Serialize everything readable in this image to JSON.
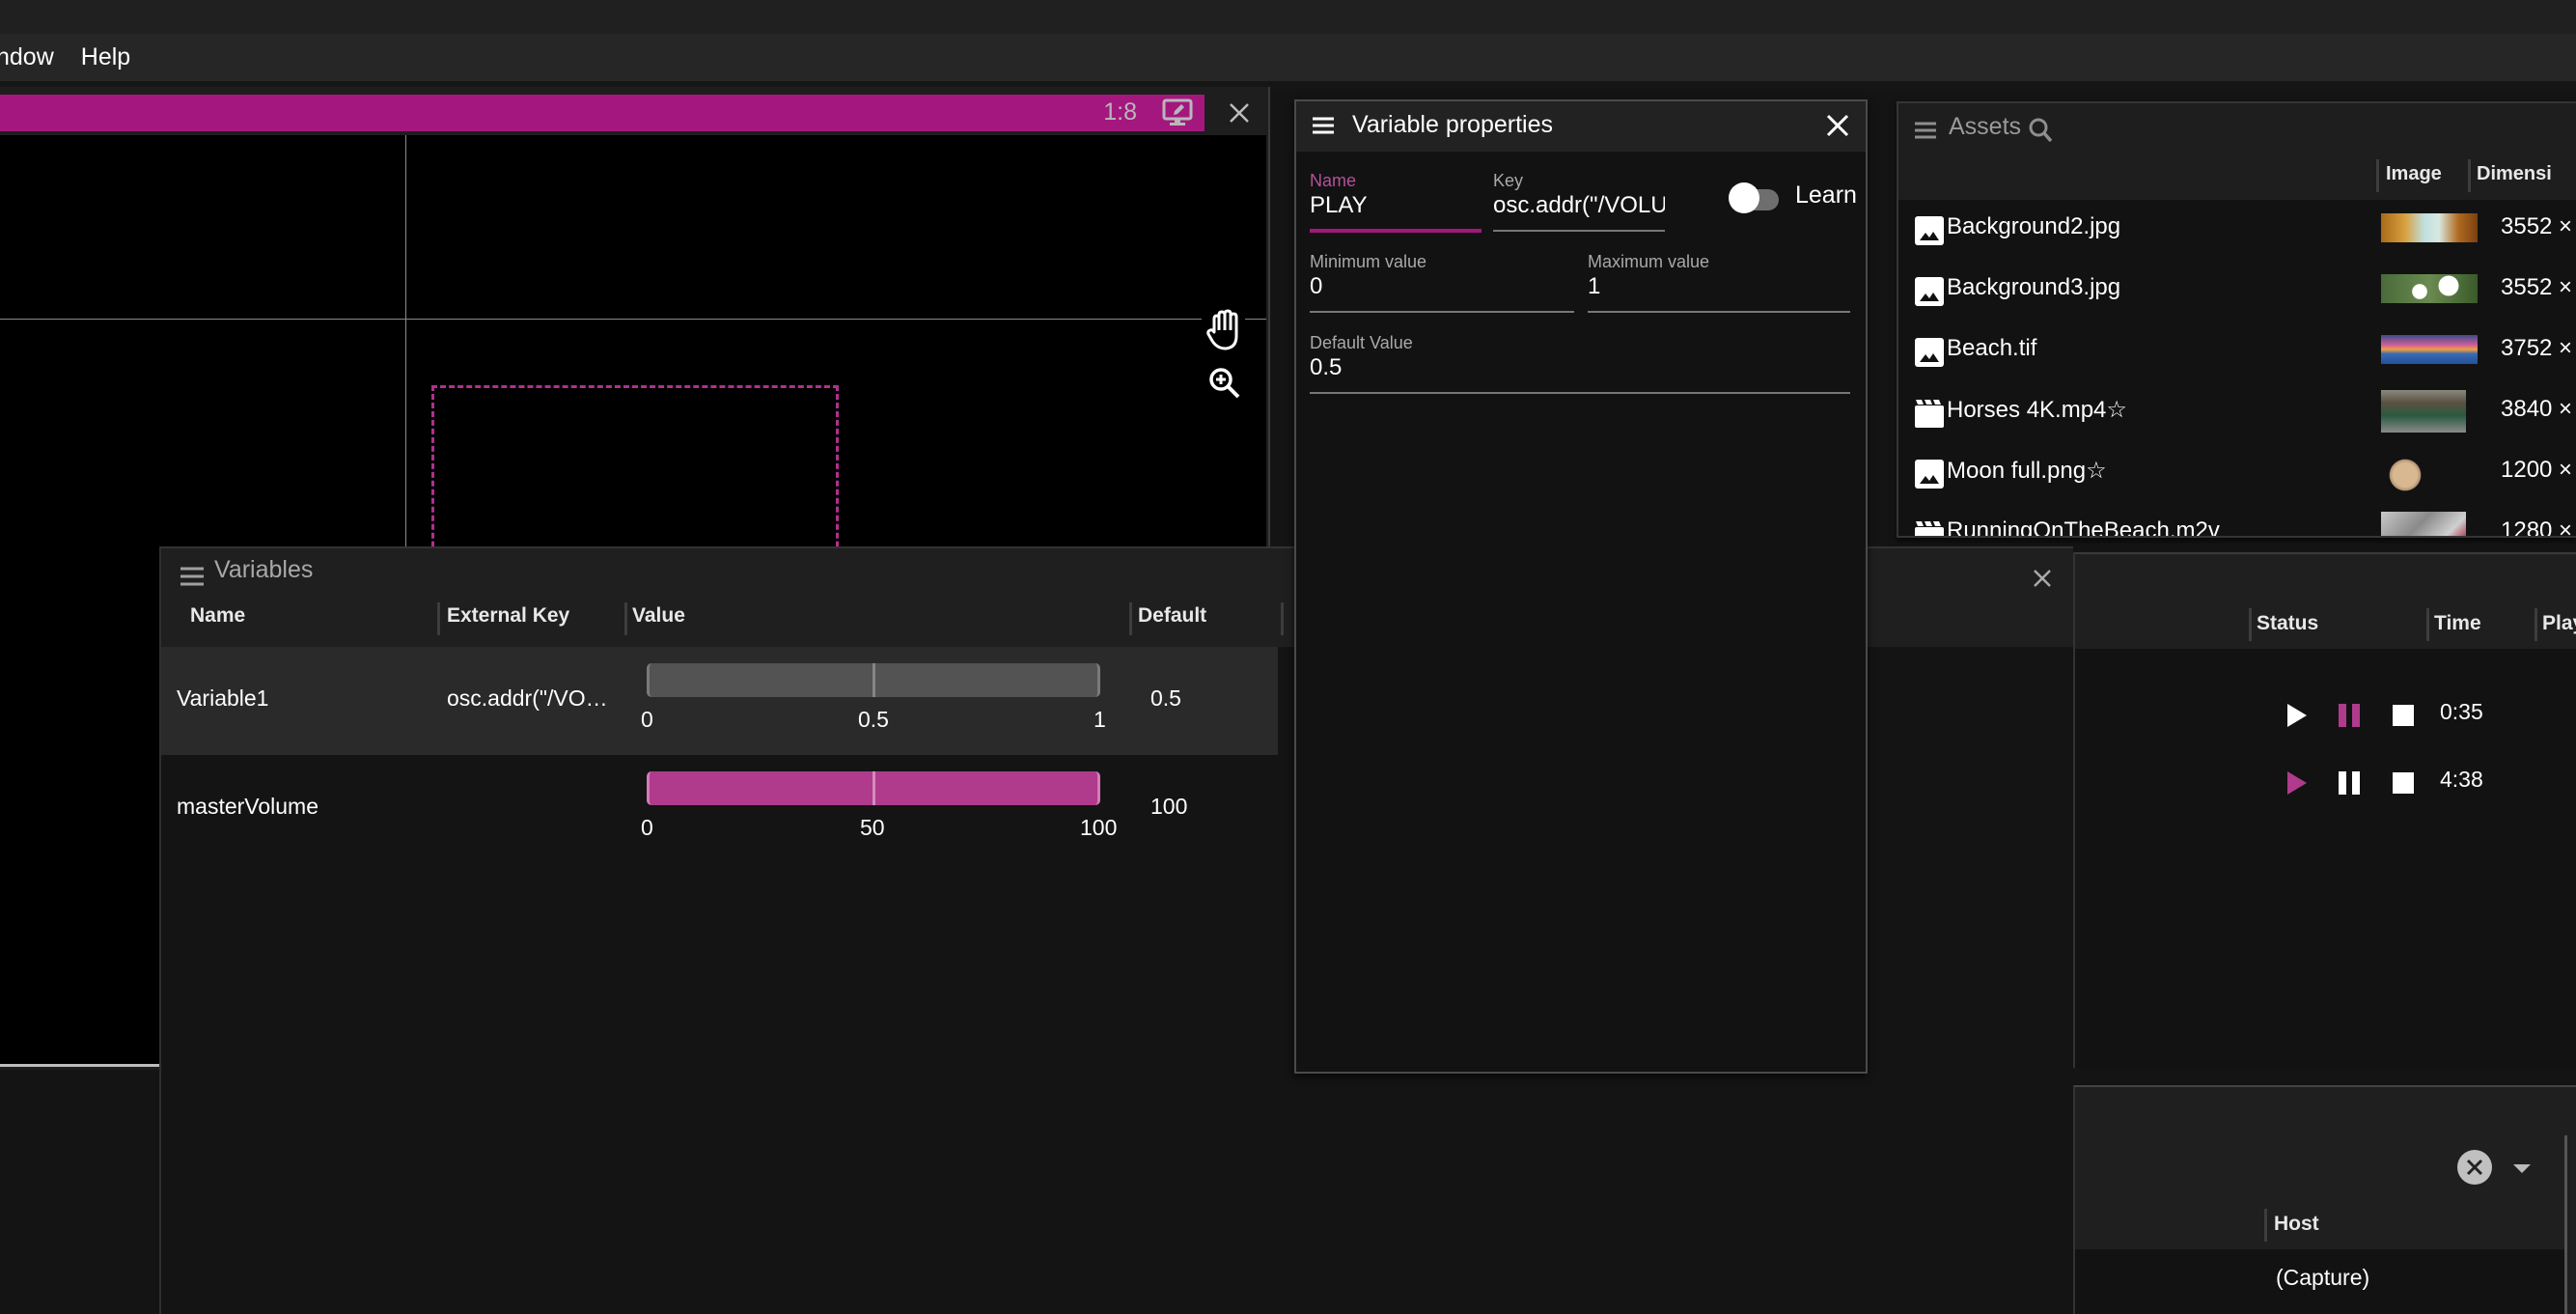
{
  "menubar": {
    "items": [
      {
        "label": "ndow"
      },
      {
        "label": "Help"
      }
    ]
  },
  "preview": {
    "ratio": "1:8",
    "accent_color": "#a4177f",
    "selection_color": "#b0308e"
  },
  "variables_panel": {
    "title": "Variables",
    "columns": [
      "Name",
      "External Key",
      "Value",
      "Default"
    ],
    "rows": [
      {
        "name": "Variable1",
        "external_key": "osc.addr(\"/VO…",
        "min_label": "0",
        "mid_label": "0.5",
        "max_label": "1",
        "min": 0,
        "max": 1,
        "value": 0.5,
        "default": "0.5",
        "selected": true
      },
      {
        "name": "masterVolume",
        "external_key": "",
        "min_label": "0",
        "mid_label": "50",
        "max_label": "100",
        "min": 0,
        "max": 100,
        "value": 100,
        "default": "100",
        "selected": false
      }
    ]
  },
  "variable_properties": {
    "title": "Variable properties",
    "name_label": "Name",
    "name_value": "PLAY",
    "key_label": "Key",
    "key_value": "osc.addr(\"/VOLUM",
    "learn_label": "Learn",
    "learn_on": false,
    "min_label": "Minimum value",
    "min_value": "0",
    "max_label": "Maximum value",
    "max_value": "1",
    "default_label": "Default Value",
    "default_value": "0.5"
  },
  "assets": {
    "title": "Assets",
    "columns": [
      "Image",
      "Dimensi"
    ],
    "items": [
      {
        "name": "Background2.jpg",
        "type": "image",
        "dimensions": "3552 ×",
        "thumb": "autumn"
      },
      {
        "name": "Background3.jpg",
        "type": "image",
        "dimensions": "3552 ×",
        "thumb": "daisies"
      },
      {
        "name": "Beach.tif",
        "type": "image",
        "dimensions": "3752 ×",
        "thumb": "sunset"
      },
      {
        "name": "Horses 4K.mp4☆",
        "type": "video",
        "dimensions": "3840 ×",
        "thumb": "horses"
      },
      {
        "name": "Moon full.png☆",
        "type": "image",
        "dimensions": "1200 ×",
        "thumb": "moon"
      },
      {
        "name": "RunningOnTheBeach.m2v",
        "type": "video",
        "dimensions": "1280 ×",
        "thumb": "running"
      }
    ]
  },
  "playback": {
    "columns": [
      "Status",
      "Time",
      "Play"
    ],
    "rows": [
      {
        "state": "paused",
        "time": "0:35"
      },
      {
        "state": "playing",
        "time": "4:38"
      }
    ],
    "active_color": "#b03a8c"
  },
  "sources": {
    "columns": [
      "Host"
    ],
    "rows": [
      {
        "host": "(Capture)"
      }
    ]
  }
}
